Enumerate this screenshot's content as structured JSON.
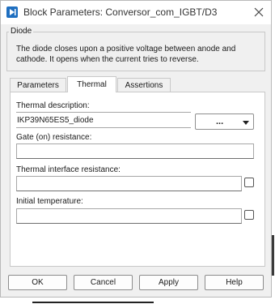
{
  "window": {
    "title": "Block Parameters: Conversor_com_IGBT/D3"
  },
  "group": {
    "title": "Diode",
    "description": "The diode closes upon a positive voltage between anode and cathode. It opens when the current tries to reverse."
  },
  "tabs": [
    {
      "label": "Parameters",
      "active": false
    },
    {
      "label": "Thermal",
      "active": true
    },
    {
      "label": "Assertions",
      "active": false
    }
  ],
  "thermal": {
    "thermal_description_label": "Thermal description:",
    "thermal_description_value": "IKP39N65ES5_diode",
    "thermal_description_dropdown": "...",
    "gate_resistance_label": "Gate (on) resistance:",
    "gate_resistance_value": "",
    "thermal_interface_label": "Thermal interface resistance:",
    "thermal_interface_value": "",
    "initial_temperature_label": "Initial temperature:",
    "initial_temperature_value": ""
  },
  "buttons": {
    "ok": "OK",
    "cancel": "Cancel",
    "apply": "Apply",
    "help": "Help"
  },
  "icons": {
    "app": "simulink-block-icon",
    "close": "close-icon",
    "dropdown": "chevron-down-icon"
  },
  "colors": {
    "app_icon": "#1f6fc0",
    "dialog_bg": "#f0f0f0",
    "panel_bg": "#ffffff"
  }
}
